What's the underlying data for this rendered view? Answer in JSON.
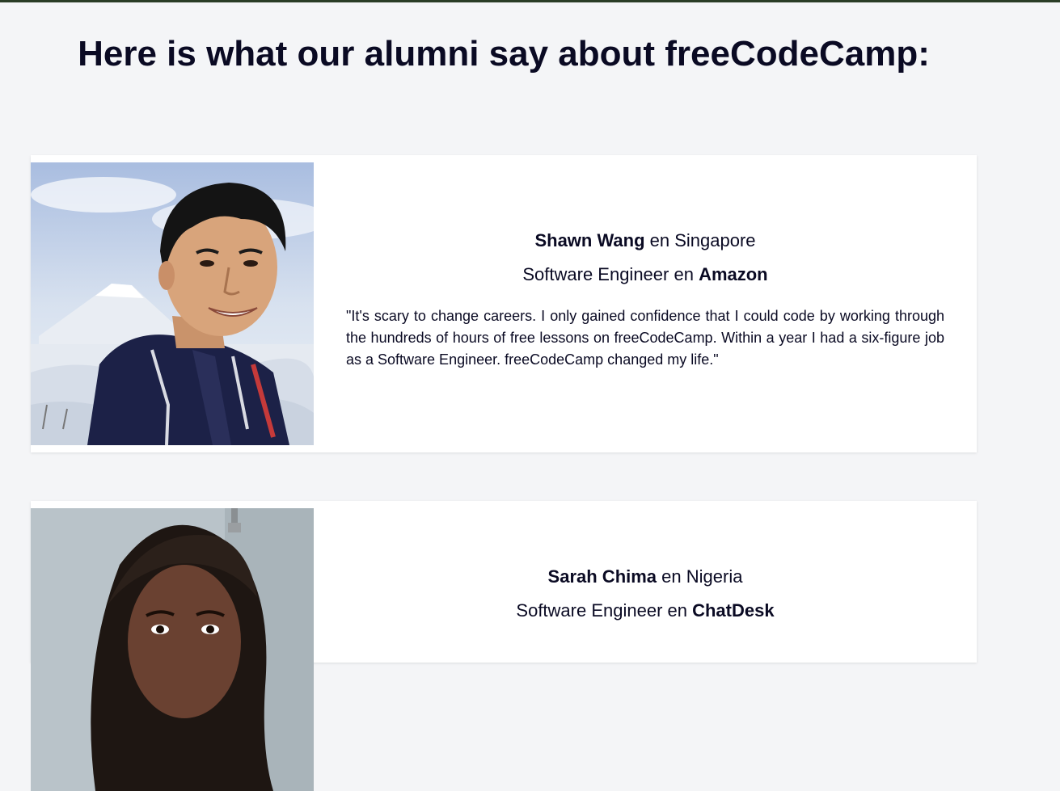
{
  "page": {
    "heading": "Here is what our alumni say about freeCodeCamp:"
  },
  "testimonials": [
    {
      "name": "Shawn Wang",
      "location_prefix": " en ",
      "location": "Singapore",
      "role": "Software Engineer",
      "company_prefix": " en ",
      "company": "Amazon",
      "quote": "\"It's scary to change careers. I only gained confidence that I could code by working through the hundreds of hours of free lessons on freeCodeCamp. Within a year I had a six-figure job as a Software Engineer. freeCodeCamp changed my life.\"",
      "photo_icon": "portrait-photo"
    },
    {
      "name": "Sarah Chima",
      "location_prefix": " en ",
      "location": "Nigeria",
      "role": "Software Engineer",
      "company_prefix": " en ",
      "company": "ChatDesk",
      "quote": "",
      "photo_icon": "portrait-photo"
    }
  ],
  "colors": {
    "background": "#f4f5f7",
    "card": "#ffffff",
    "text": "#0a0a23",
    "top_rule": "#2a3d26"
  }
}
